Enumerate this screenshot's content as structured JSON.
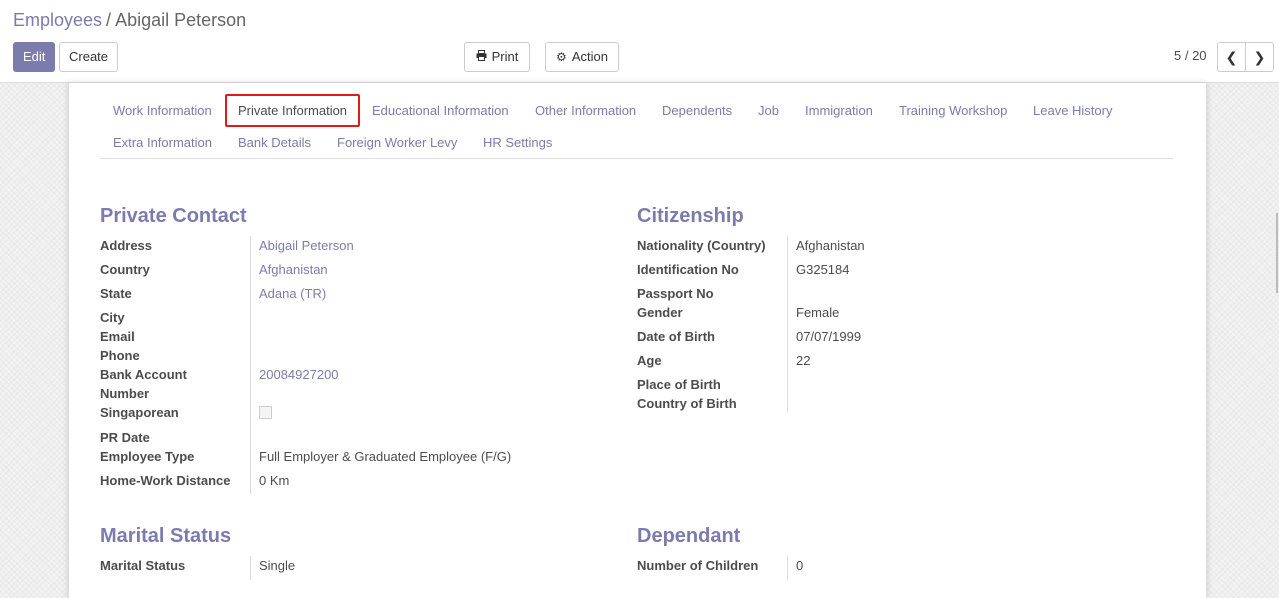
{
  "breadcrumb": {
    "parent": "Employees",
    "separator": "/",
    "current": "Abigail Peterson"
  },
  "toolbar": {
    "edit_label": "Edit",
    "create_label": "Create",
    "print_label": "Print",
    "action_label": "Action"
  },
  "pager": {
    "value": "5 / 20"
  },
  "tabs": {
    "row1": [
      "Work Information",
      "Private Information",
      "Educational Information",
      "Other Information",
      "Dependents",
      "Job",
      "Immigration",
      "Training Workshop",
      "Leave History"
    ],
    "row2": [
      "Extra Information",
      "Bank Details",
      "Foreign Worker Levy",
      "HR Settings"
    ],
    "active": "Private Information"
  },
  "private_contact": {
    "title": "Private Contact",
    "address_label": "Address",
    "address_value": "Abigail Peterson",
    "country_label": "Country",
    "country_value": "Afghanistan",
    "state_label": "State",
    "state_value": "Adana (TR)",
    "city_label": "City",
    "email_label": "Email",
    "phone_label": "Phone",
    "bank_label_1": "Bank Account",
    "bank_label_2": "Number",
    "bank_value": "20084927200",
    "singaporean_label": "Singaporean",
    "singaporean_checked": false,
    "pr_date_label": "PR Date",
    "employee_type_label": "Employee Type",
    "employee_type_value": "Full Employer & Graduated Employee (F/G)",
    "distance_label": "Home-Work Distance",
    "distance_value": "0",
    "distance_unit": "Km"
  },
  "citizenship": {
    "title": "Citizenship",
    "nationality_label": "Nationality (Country)",
    "nationality_value": "Afghanistan",
    "id_label": "Identification No",
    "id_value": "G325184",
    "passport_label": "Passport No",
    "gender_label": "Gender",
    "gender_value": "Female",
    "dob_label": "Date of Birth",
    "dob_value": "07/07/1999",
    "age_label": "Age",
    "age_value": "22",
    "pob_label": "Place of Birth",
    "cob_label": "Country of Birth"
  },
  "marital": {
    "title": "Marital Status",
    "label": "Marital Status",
    "value": "Single"
  },
  "dependant": {
    "title": "Dependant",
    "children_label": "Number of Children",
    "children_value": "0"
  },
  "colors": {
    "accent": "#7c7bad",
    "highlight": "#e01b1b",
    "text": "#4c4c4c"
  }
}
